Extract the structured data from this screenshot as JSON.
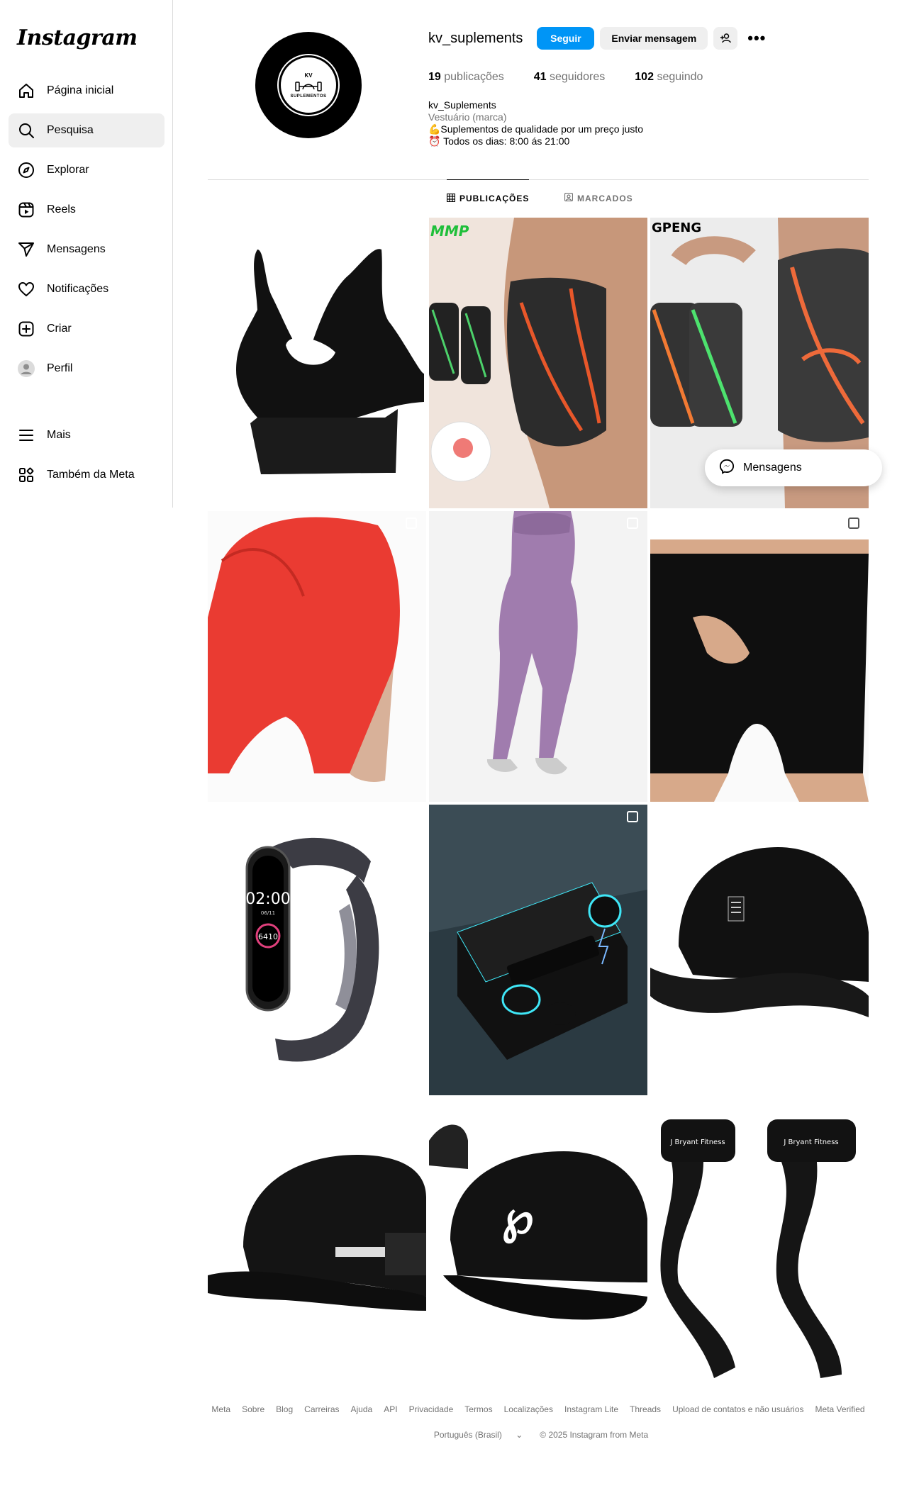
{
  "sidebar": {
    "logo": "Instagram",
    "items": [
      {
        "label": "Página inicial",
        "icon": "home-icon"
      },
      {
        "label": "Pesquisa",
        "icon": "search-icon"
      },
      {
        "label": "Explorar",
        "icon": "compass-icon"
      },
      {
        "label": "Reels",
        "icon": "reels-icon"
      },
      {
        "label": "Mensagens",
        "icon": "send-icon"
      },
      {
        "label": "Notificações",
        "icon": "heart-icon"
      },
      {
        "label": "Criar",
        "icon": "plus-icon"
      },
      {
        "label": "Perfil",
        "icon": "profile-avatar-icon"
      }
    ],
    "bottom_items": [
      {
        "label": "Mais",
        "icon": "menu-icon"
      },
      {
        "label": "Também da Meta",
        "icon": "meta-apps-icon"
      }
    ]
  },
  "profile": {
    "username": "kv_suplements",
    "avatar_top_text": "KV",
    "avatar_bottom_text": "SUPLEMENTOS",
    "follow_label": "Seguir",
    "message_label": "Enviar mensagem",
    "posts_count": "19",
    "posts_label": "publicações",
    "followers_count": "41",
    "followers_label": "seguidores",
    "following_count": "102",
    "following_label": "seguindo",
    "display_name": "kv_Suplements",
    "category": "Vestuário (marca)",
    "bio_line1": "💪Suplementos de qualidade por um preço justo",
    "bio_line2": "⏰ Todos os dias: 8:00 ás 21:00"
  },
  "tabs": {
    "posts": "PUBLICAÇÕES",
    "tagged": "MARCADOS"
  },
  "grid": {
    "tiles": [
      {
        "subject": "sports-bra",
        "brand_text": ""
      },
      {
        "subject": "elbow-sleeve",
        "brand_text": "MMP"
      },
      {
        "subject": "knee-sleeve",
        "brand_text": "GPENG"
      },
      {
        "subject": "red-shorts",
        "brand_text": ""
      },
      {
        "subject": "purple-leggings",
        "brand_text": ""
      },
      {
        "subject": "black-shorts",
        "brand_text": ""
      },
      {
        "subject": "smart-band",
        "time": "02:00",
        "date": "06/11",
        "steps": "6410"
      },
      {
        "subject": "earbuds",
        "brand_text": ""
      },
      {
        "subject": "black-cap",
        "brand_text": ""
      },
      {
        "subject": "mesh-cap",
        "brand_text": ""
      },
      {
        "subject": "ny-cap",
        "brand_text": ""
      },
      {
        "subject": "lifting-straps",
        "brand_text": "J Bryant Fitness"
      }
    ]
  },
  "floating": {
    "messages_label": "Mensagens"
  },
  "footer": {
    "links": [
      "Meta",
      "Sobre",
      "Blog",
      "Carreiras",
      "Ajuda",
      "API",
      "Privacidade",
      "Termos",
      "Localizações",
      "Instagram Lite",
      "Threads",
      "Upload de contatos e não usuários",
      "Meta Verified"
    ],
    "language": "Português (Brasil)",
    "copyright": "© 2025 Instagram from Meta"
  }
}
